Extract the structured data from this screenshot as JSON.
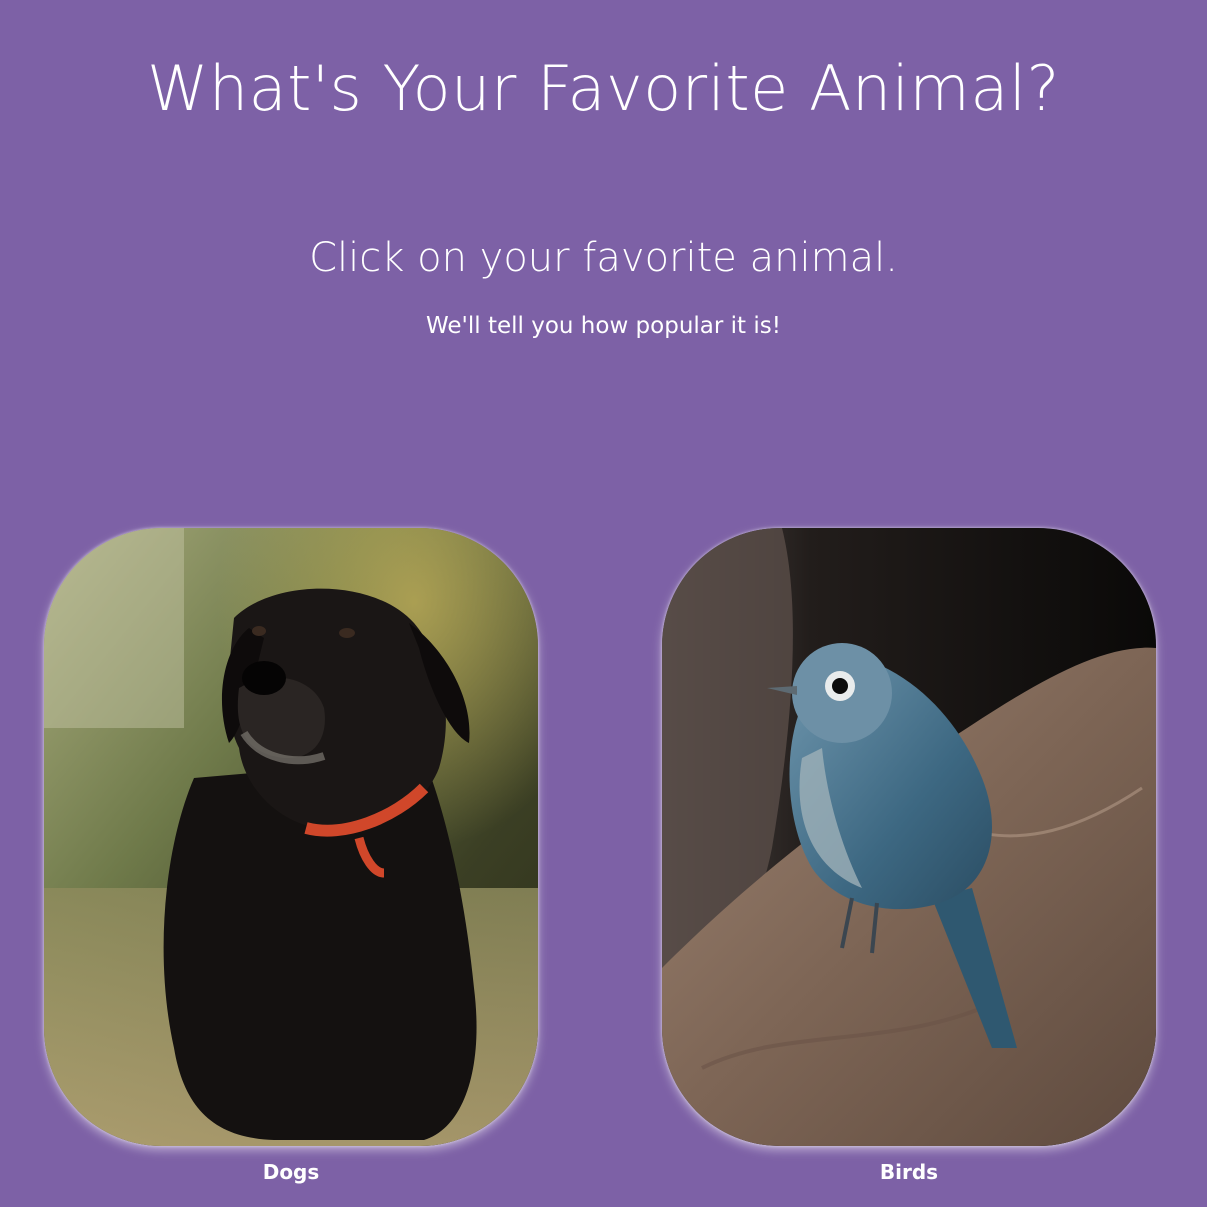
{
  "page": {
    "title": "What's Your Favorite Animal?",
    "instruction": "Click on your favorite animal.",
    "subtext": "We'll tell you how popular it is!"
  },
  "animals": [
    {
      "label": "Dogs",
      "image": "dog-photo"
    },
    {
      "label": "Birds",
      "image": "bird-photo"
    }
  ],
  "colors": {
    "background": "#7d61a6",
    "text": "#ffffff"
  }
}
